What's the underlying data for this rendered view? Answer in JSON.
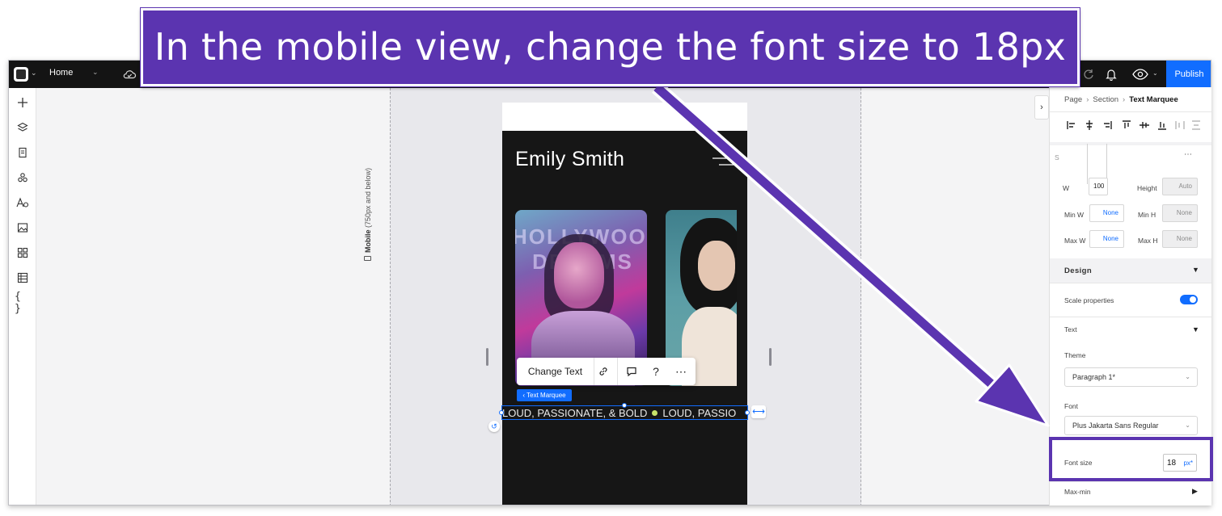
{
  "instruction": {
    "banner_text": "In the mobile view, change the font size to 18px",
    "accent_color": "#5b34b0"
  },
  "topbar": {
    "page_name": "Home",
    "publish_label": "Publish",
    "publish_color": "#116dff",
    "icons": [
      "wix-logo-icon",
      "cloud-save-icon",
      "redo-icon",
      "bell-icon",
      "preview-eye-icon"
    ]
  },
  "left_toolbar": {
    "tools": [
      "add-icon",
      "layers-icon",
      "pages-icon",
      "apps-icon",
      "fonts-icon",
      "media-icon",
      "app-market-icon",
      "cms-table-icon",
      "code-icon"
    ],
    "code_glyph": "{ }"
  },
  "canvas": {
    "breakpoint_title": "Mobile",
    "breakpoint_range": "(750px and below)",
    "site_name": "Emily Smith",
    "photo1_text": "HOLLYWOOD DREAMS",
    "floating_toolbar": {
      "change_text_label": "Change Text",
      "help_glyph": "?",
      "more_glyph": "⋯"
    },
    "element_tag": "‹ Text Marquee",
    "marquee_text_1": "LOUD, PASSIONATE, & BOLD",
    "marquee_text_2": "LOUD, PASSIO",
    "marquee_dot_color": "#c7e36a"
  },
  "inspector": {
    "breadcrumb": [
      "Page",
      "Section",
      "Text Marquee"
    ],
    "more_glyph": "⋯",
    "size_fields": {
      "width_label": "W",
      "width_value": "100",
      "height_label": "Height",
      "height_value": "Auto",
      "min_w_label": "Min W",
      "min_w_value": "None",
      "min_h_label": "Min H",
      "min_h_value": "None",
      "max_w_label": "Max W",
      "max_w_value": "None",
      "max_h_label": "Max H",
      "max_h_value": "None"
    },
    "design_label": "Design",
    "scale_properties_label": "Scale properties",
    "scale_properties_on": true,
    "text_label": "Text",
    "theme_label": "Theme",
    "theme_value": "Paragraph 1*",
    "font_label": "Font",
    "font_value": "Plus Jakarta Sans Regular",
    "font_size_label": "Font size",
    "font_size_value": "18",
    "font_size_unit": "px*",
    "max_min_label": "Max-min"
  }
}
